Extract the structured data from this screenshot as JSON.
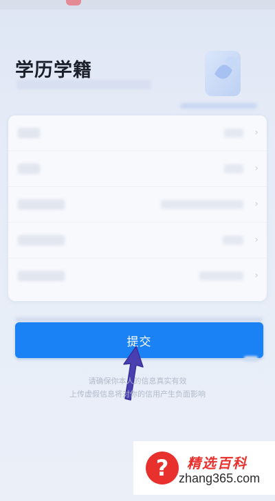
{
  "page": {
    "title": "学历学籍"
  },
  "form": {
    "rows": [
      {
        "label_width": "short",
        "value_width": "short"
      },
      {
        "label_width": "short",
        "value_width": "short"
      },
      {
        "label_width": "long",
        "value_width": "long"
      },
      {
        "label_width": "long",
        "value_width": "short"
      },
      {
        "label_width": "long",
        "value_width": "medium"
      }
    ]
  },
  "submit": {
    "label": "提交"
  },
  "notice": {
    "line1": "请确保你本人的信息真实有效",
    "line2": "上传虚假信息将对你的信用产生负面影响"
  },
  "watermark": {
    "icon": "?",
    "title": "精选百科",
    "url": "zhang365.com"
  },
  "colors": {
    "accent": "#1a82f5",
    "watermark_red": "#e8302d",
    "arrow": "#4a3fb0"
  }
}
